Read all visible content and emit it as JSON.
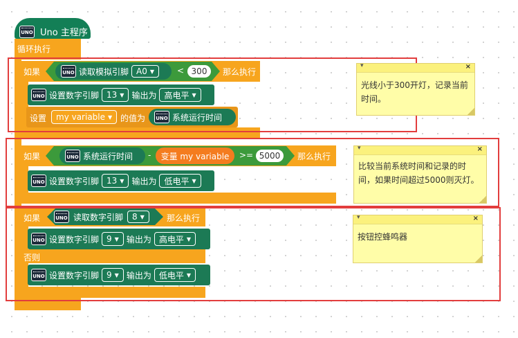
{
  "program": {
    "hat_label": "Uno 主程序",
    "loop_label": "循环执行"
  },
  "section1": {
    "if_label": "如果",
    "read_analog_label": "读取模拟引脚",
    "analog_pin": "A0",
    "compare_op": "<",
    "threshold": "300",
    "then_label": "那么执行",
    "set_digital_label": "设置数字引脚",
    "digital_pin": "13",
    "output_as": "输出为",
    "level": "高电平",
    "set_label": "设置",
    "variable_name": "my variable",
    "value_of": "的值为",
    "runtime_label": "系统运行时间"
  },
  "section2": {
    "if_label": "如果",
    "runtime_label": "系统运行时间",
    "minus": "-",
    "variable_label": "变量 my variable",
    "compare_op": ">=",
    "threshold": "5000",
    "then_label": "那么执行",
    "set_digital_label": "设置数字引脚",
    "digital_pin": "13",
    "output_as": "输出为",
    "level": "低电平"
  },
  "section3": {
    "if_label": "如果",
    "read_digital_label": "读取数字引脚",
    "read_pin": "8",
    "then_label": "那么执行",
    "set_digital_label": "设置数字引脚",
    "pin_a": "9",
    "output_as": "输出为",
    "level_a": "高电平",
    "else_label": "否则",
    "pin_b": "9",
    "level_b": "低电平"
  },
  "notes": [
    {
      "text": "光线小于300开灯，记录当前时间。"
    },
    {
      "text": "比较当前系统时间和记录的时间，如果时间超过5000则灭灯。"
    },
    {
      "text": "按钮控蜂鸣器"
    }
  ],
  "icons": {
    "collapse": "▾",
    "close": "×",
    "dropdown": "▼"
  },
  "uno_chip_text": "UNO",
  "colors": {
    "control": "#f7a51e",
    "block": "#1c7a55",
    "logic": "#3c9a3b",
    "highlight": "#e23d3d",
    "note": "#fffda8"
  }
}
